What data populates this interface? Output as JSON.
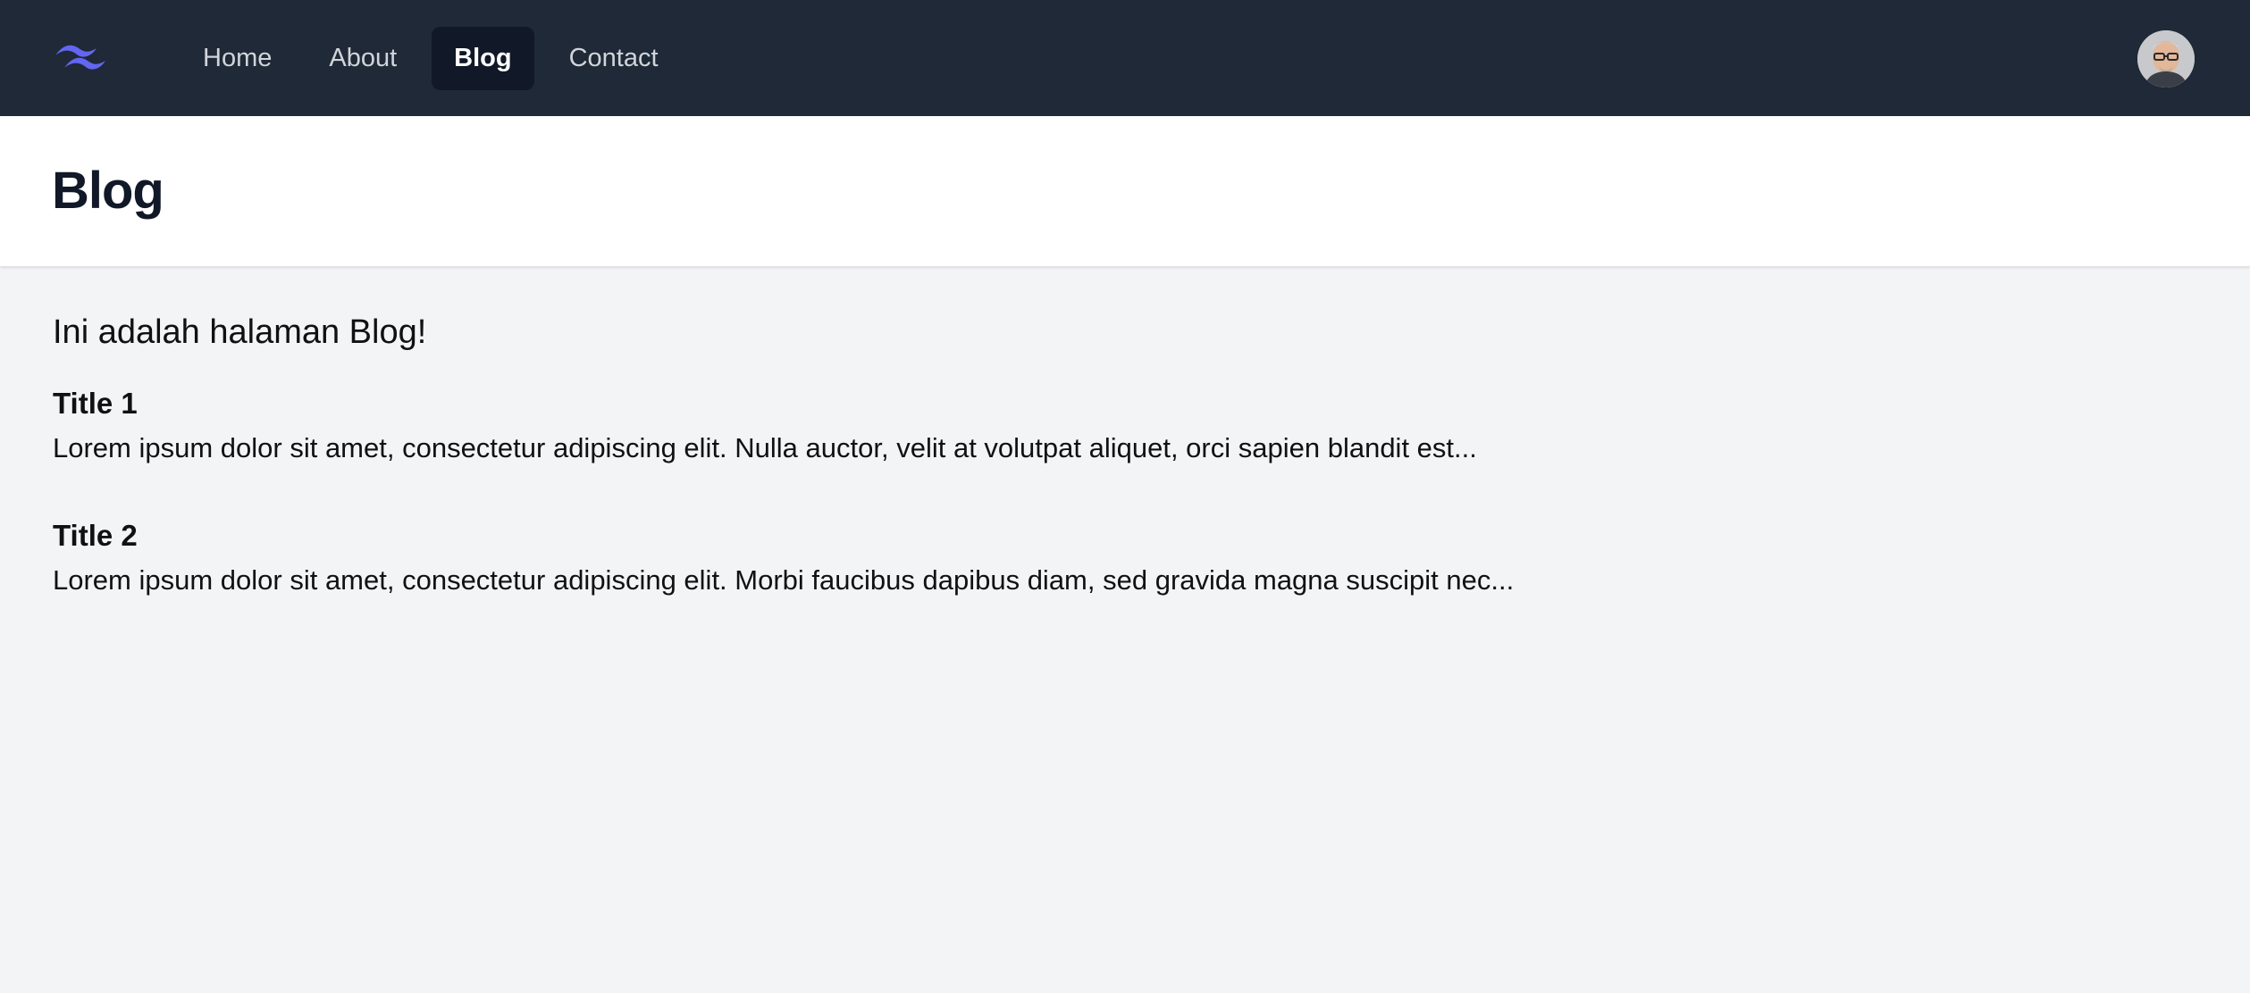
{
  "app": {
    "nav": {
      "items": [
        {
          "label": "Home",
          "active": false
        },
        {
          "label": "About",
          "active": false
        },
        {
          "label": "Blog",
          "active": true
        },
        {
          "label": "Contact",
          "active": false
        }
      ]
    },
    "logo": {
      "icon": "tailwind-wave-logo",
      "color": "#6366f1"
    },
    "avatar": {
      "icon": "user-avatar"
    }
  },
  "header": {
    "title": "Blog"
  },
  "main": {
    "intro": "Ini adalah halaman Blog!",
    "posts": [
      {
        "title": "Title 1",
        "excerpt": "Lorem ipsum dolor sit amet, consectetur adipiscing elit. Nulla auctor, velit at volutpat aliquet, orci sapien blandit est..."
      },
      {
        "title": "Title 2",
        "excerpt": "Lorem ipsum dolor sit amet, consectetur adipiscing elit. Morbi faucibus dapibus diam, sed gravida magna suscipit nec..."
      }
    ]
  },
  "colors": {
    "navbar_bg": "#1f2937",
    "nav_active_bg": "#111827",
    "page_bg": "#f3f4f6",
    "header_bg": "#ffffff",
    "accent": "#6366f1"
  }
}
